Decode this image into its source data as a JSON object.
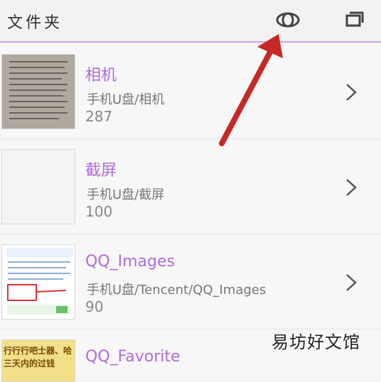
{
  "header": {
    "title": "文件夹",
    "icons": [
      "eye-icon",
      "window-icon"
    ]
  },
  "folders": [
    {
      "name": "相机",
      "path": "手机U盘/相机",
      "count": "287"
    },
    {
      "name": "截屏",
      "path": "手机U盘/截屏",
      "count": "100"
    },
    {
      "name": "QQ_Images",
      "path": "手机U盘/Tencent/QQ_Images",
      "count": "90"
    },
    {
      "name": "QQ_Favorite",
      "path": "",
      "count": ""
    }
  ],
  "thumb_text": {
    "qq_favorite": "行行行吧士器、哈三天内的过钱"
  },
  "watermark": "易坊好文馆",
  "colors": {
    "accent": "#b06bd8",
    "header_line": "#c9a4ea",
    "arrow": "#c62828"
  }
}
